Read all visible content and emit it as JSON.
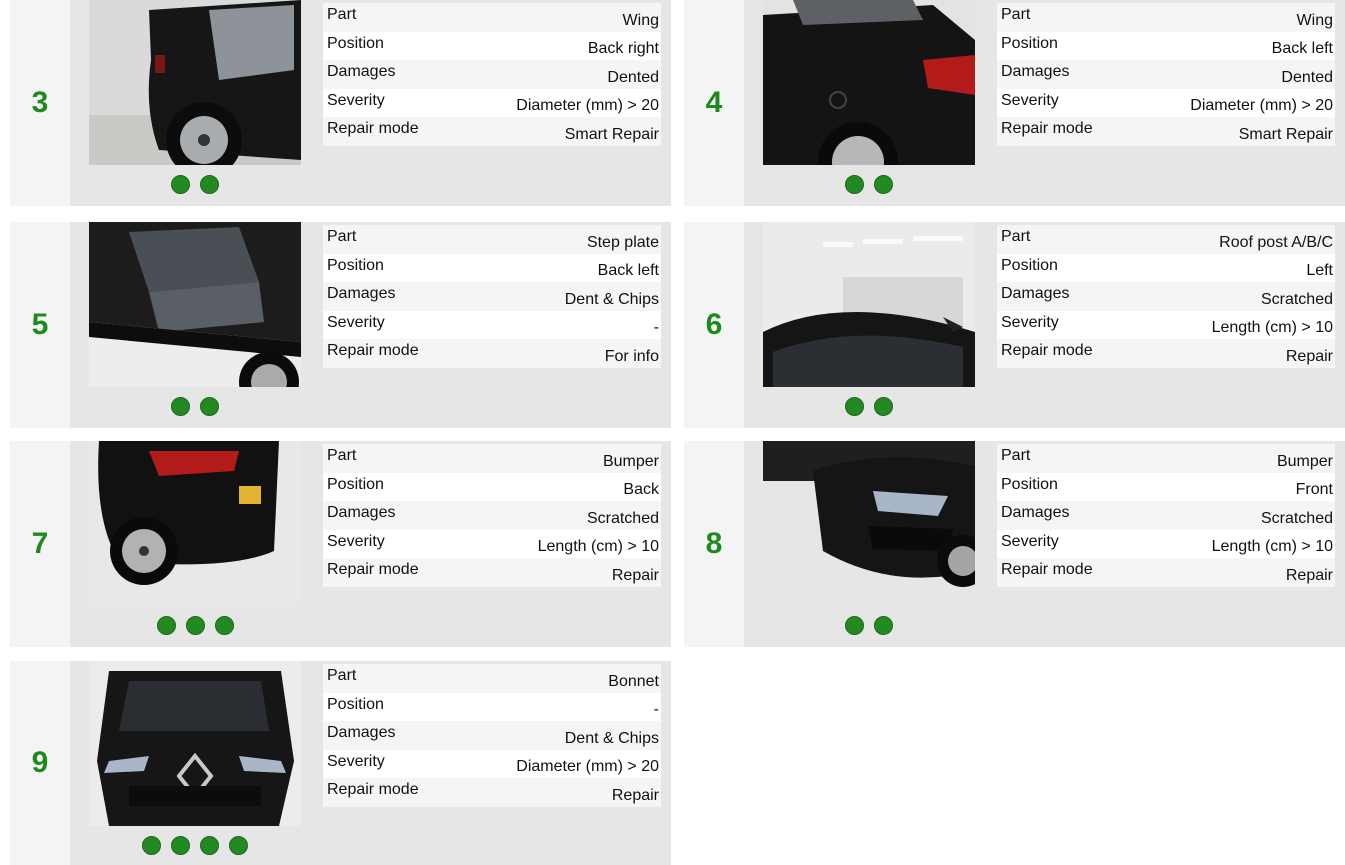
{
  "labels": {
    "part": "Part",
    "position": "Position",
    "damages": "Damages",
    "severity": "Severity",
    "repair_mode": "Repair mode"
  },
  "colors": {
    "accent": "#1e8a1e",
    "dot": "#238a23",
    "card_bg": "#e6e6e6"
  },
  "damages": [
    {
      "number": "3",
      "part": "Wing",
      "position": "Back right",
      "damages": "Dented",
      "severity": "Diameter (mm) > 20",
      "repair_mode": "Smart Repair",
      "photo_count": 2,
      "photo_icon": "car-rear-right-wing-photo"
    },
    {
      "number": "4",
      "part": "Wing",
      "position": "Back left",
      "damages": "Dented",
      "severity": "Diameter (mm) > 20",
      "repair_mode": "Smart Repair",
      "photo_count": 2,
      "photo_icon": "car-rear-left-wing-photo"
    },
    {
      "number": "5",
      "part": "Step plate",
      "position": "Back left",
      "damages": "Dent & Chips",
      "severity": "-",
      "repair_mode": "For info",
      "photo_count": 2,
      "photo_icon": "car-step-plate-photo"
    },
    {
      "number": "6",
      "part": "Roof post A/B/C",
      "position": "Left",
      "damages": "Scratched",
      "severity": "Length (cm) > 10",
      "repair_mode": "Repair",
      "photo_count": 2,
      "photo_icon": "car-roof-post-photo"
    },
    {
      "number": "7",
      "part": "Bumper",
      "position": "Back",
      "damages": "Scratched",
      "severity": "Length (cm) > 10",
      "repair_mode": "Repair",
      "photo_count": 3,
      "photo_icon": "car-rear-bumper-photo"
    },
    {
      "number": "8",
      "part": "Bumper",
      "position": "Front",
      "damages": "Scratched",
      "severity": "Length (cm) > 10",
      "repair_mode": "Repair",
      "photo_count": 2,
      "photo_icon": "car-front-bumper-photo"
    },
    {
      "number": "9",
      "part": "Bonnet",
      "position": "-",
      "damages": "Dent & Chips",
      "severity": "Diameter (mm) > 20",
      "repair_mode": "Repair",
      "photo_count": 4,
      "photo_icon": "car-bonnet-photo"
    }
  ]
}
